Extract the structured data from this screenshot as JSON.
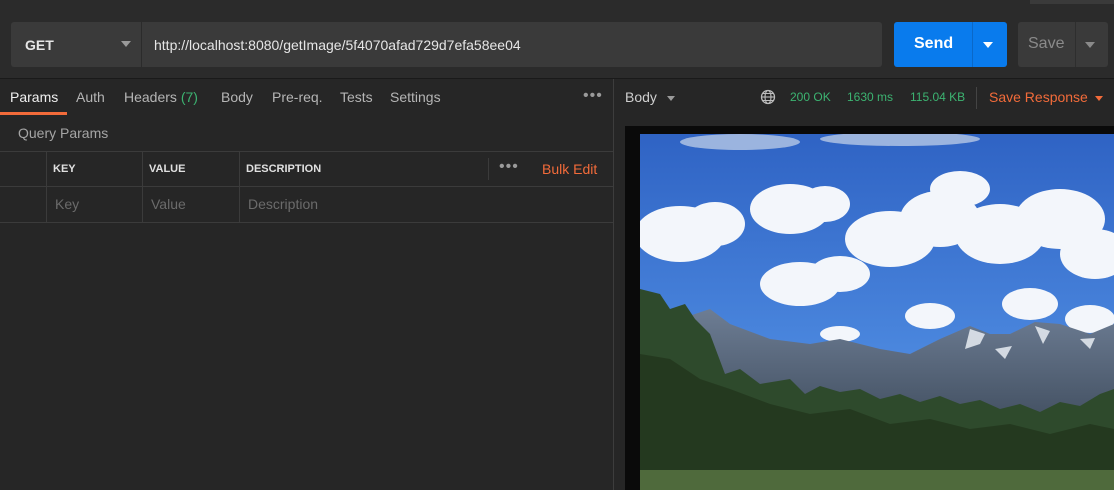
{
  "request": {
    "method": "GET",
    "url": "http://localhost:8080/getImage/5f4070afad729d7efa58ee04"
  },
  "toolbar": {
    "send_label": "Send",
    "save_label": "Save"
  },
  "request_tabs": [
    {
      "label": "Params"
    },
    {
      "label": "Auth"
    },
    {
      "label": "Headers",
      "count": "(7)"
    },
    {
      "label": "Body"
    },
    {
      "label": "Pre-req."
    },
    {
      "label": "Tests"
    },
    {
      "label": "Settings"
    }
  ],
  "params": {
    "section_title": "Query Params",
    "columns": [
      "KEY",
      "VALUE",
      "DESCRIPTION"
    ],
    "bulk_edit": "Bulk Edit",
    "placeholders": {
      "key": "Key",
      "value": "Value",
      "description": "Description"
    }
  },
  "response": {
    "view_label": "Body",
    "status": "200 OK",
    "time": "1630 ms",
    "size": "115.04 KB",
    "save_label": "Save Response"
  },
  "colors": {
    "accent": "#f26b3a",
    "send": "#097bed",
    "success": "#3cb371"
  }
}
